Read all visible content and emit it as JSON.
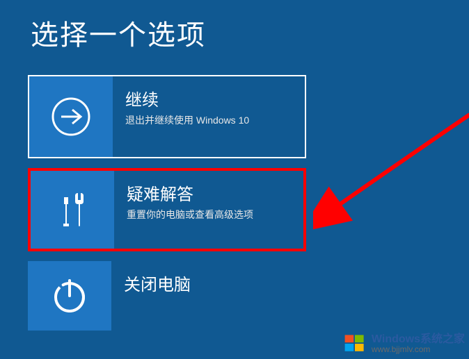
{
  "title": "选择一个选项",
  "options": [
    {
      "icon": "arrow-right",
      "title": "继续",
      "desc": "退出并继续使用 Windows 10"
    },
    {
      "icon": "tools",
      "title": "疑难解答",
      "desc": "重置你的电脑或查看高级选项"
    },
    {
      "icon": "power",
      "title": "关闭电脑",
      "desc": ""
    }
  ],
  "watermark": {
    "brand": "Windows系统之家",
    "url": "www.bjjmlv.com"
  }
}
